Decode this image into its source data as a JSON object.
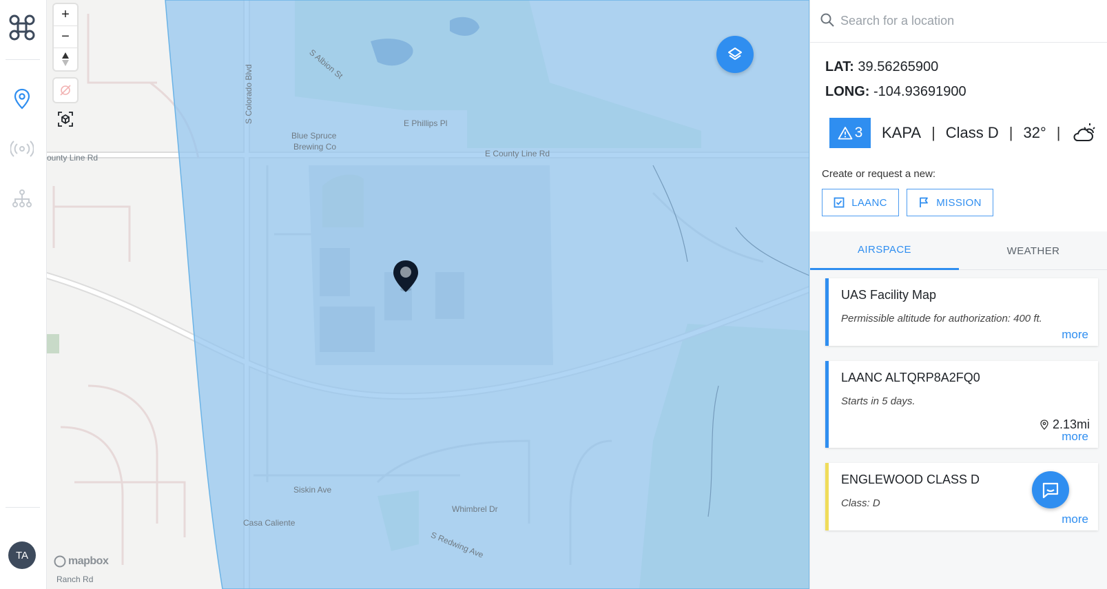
{
  "nav": {
    "items": [
      {
        "name": "location-pin-icon",
        "active": true
      },
      {
        "name": "broadcast-icon",
        "active": false
      },
      {
        "name": "hierarchy-icon",
        "active": false
      }
    ],
    "user_initials": "TA"
  },
  "map": {
    "controls": {
      "zoom_in": "+",
      "zoom_out": "−"
    },
    "labels": {
      "county_line_left": "ounty Line Rd",
      "county_line_right": "E County Line Rd",
      "colorado_blvd": "S Colorado Blvd",
      "albion": "S Albion St",
      "phillips": "E Phillips Pl",
      "brewery_line1": "Blue Spruce",
      "brewery_line2": "Brewing Co",
      "siskin": "Siskin Ave",
      "whimbrel": "Whimbrel Dr",
      "redwing": "S Redwing Ave",
      "casa": "Casa Caliente",
      "ranch": "Ranch Rd"
    },
    "attribution": "mapbox",
    "colors": {
      "airspace": "#a9d3f5",
      "accent": "#2f8ef0"
    }
  },
  "search": {
    "placeholder": "Search for a location",
    "value": ""
  },
  "location": {
    "lat_label": "LAT:",
    "lat": "39.56265900",
    "long_label": "LONG:",
    "long": "-104.93691900"
  },
  "status": {
    "warning_count": "3",
    "airport": "KAPA",
    "airspace_class": "Class D",
    "temperature": "32°",
    "weather_icon": "partly-cloudy-icon"
  },
  "create": {
    "label": "Create or request a new:",
    "laanc_label": "LAANC",
    "mission_label": "MISSION"
  },
  "tabs": [
    {
      "label": "AIRSPACE",
      "active": true
    },
    {
      "label": "WEATHER",
      "active": false
    }
  ],
  "cards": [
    {
      "title": "UAS Facility Map",
      "description": "Permissible altitude for authorization: 400 ft.",
      "more": "more",
      "accent": "#2f8ef0"
    },
    {
      "title": "LAANC ALTQRP8A2FQ0",
      "description": "Starts in 5 days.",
      "distance": "2.13mi",
      "more": "more",
      "accent": "#2f8ef0"
    },
    {
      "title": "ENGLEWOOD CLASS D",
      "description": "Class: D",
      "more": "more",
      "accent": "#f0dc5a"
    }
  ]
}
